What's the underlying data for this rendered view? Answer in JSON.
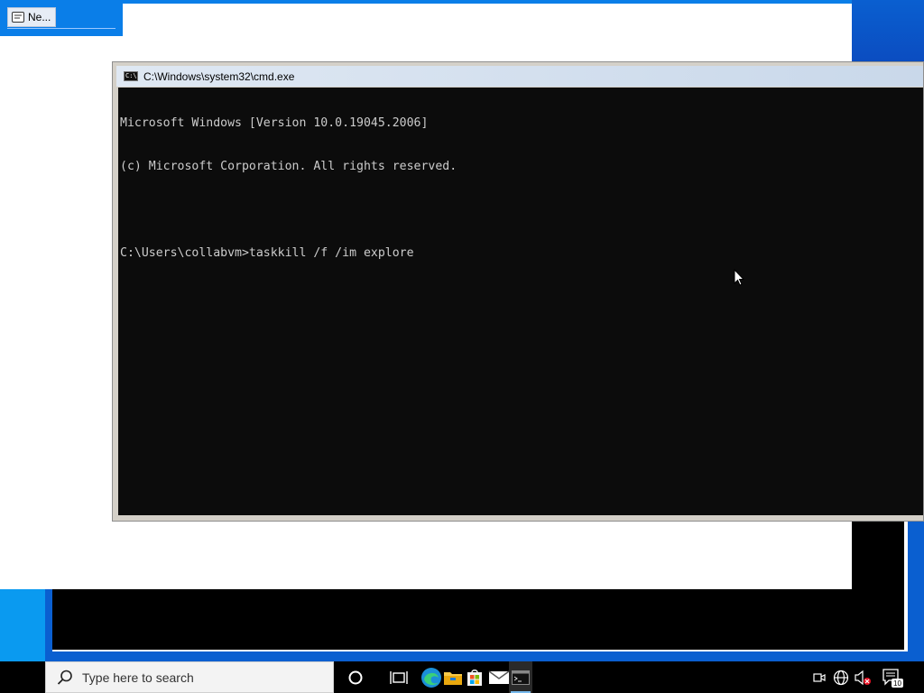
{
  "desktop": {
    "tab_label": "Ne..."
  },
  "cmd_window": {
    "title": "C:\\Windows\\system32\\cmd.exe",
    "lines": [
      "Microsoft Windows [Version 10.0.19045.2006]",
      "(c) Microsoft Corporation. All rights reserved.",
      "",
      "C:\\Users\\collabvm>taskkill /f /im explore"
    ]
  },
  "taskbar": {
    "search_placeholder": "Type here to search",
    "notification_count": "10"
  },
  "icons": {
    "cmd": "cmd-icon",
    "search": "search-icon",
    "cortana": "cortana-icon",
    "taskview": "task-view-icon",
    "edge": "edge-icon",
    "explorer": "file-explorer-icon",
    "store": "store-icon",
    "mail": "mail-icon",
    "meet": "meet-now-icon",
    "network": "network-icon",
    "volume": "volume-muted-icon",
    "notifications": "action-center-icon"
  },
  "colors": {
    "console_bg": "#0c0c0c",
    "console_text": "#cccccc",
    "taskbar_bg": "#000000",
    "desktop_blue": "#0a5fd0"
  }
}
